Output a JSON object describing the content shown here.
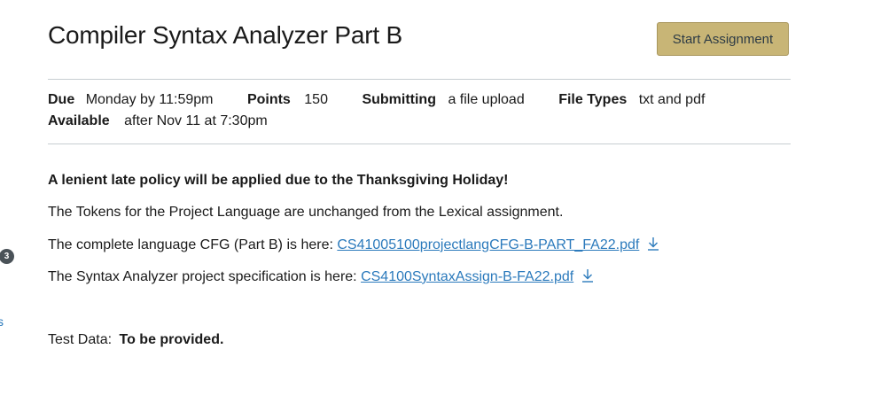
{
  "sidebar": {
    "badge_count": "3",
    "partial_link": "s"
  },
  "assignment": {
    "title": "Compiler Syntax Analyzer Part B",
    "start_button": "Start Assignment"
  },
  "details": {
    "due_label": "Due",
    "due_value": "Monday by 11:59pm",
    "points_label": "Points",
    "points_value": "150",
    "submitting_label": "Submitting",
    "submitting_value": "a file upload",
    "filetypes_label": "File Types",
    "filetypes_value": "txt and pdf",
    "available_label": "Available",
    "available_value": "after Nov 11 at 7:30pm"
  },
  "description": {
    "late_policy": "A lenient late policy will be applied due to the Thanksgiving Holiday!",
    "tokens_text": "The Tokens for the Project Language are  unchanged from the Lexical assignment.",
    "cfg_text": "The complete language CFG  (Part B) is here: ",
    "cfg_file": "CS41005100projectlangCFG-B-PART_FA22.pdf",
    "spec_text": "The Syntax Analyzer project specification is here: ",
    "spec_file": "CS4100SyntaxAssign-B-FA22.pdf",
    "testdata_label": "Test Data: ",
    "testdata_value": "To be provided."
  },
  "icons": {
    "download": "download-icon",
    "badge": "notification-badge"
  },
  "colors": {
    "link": "#2b7abc",
    "start_button_bg": "#c8b576",
    "rule": "#c7cdd1"
  }
}
